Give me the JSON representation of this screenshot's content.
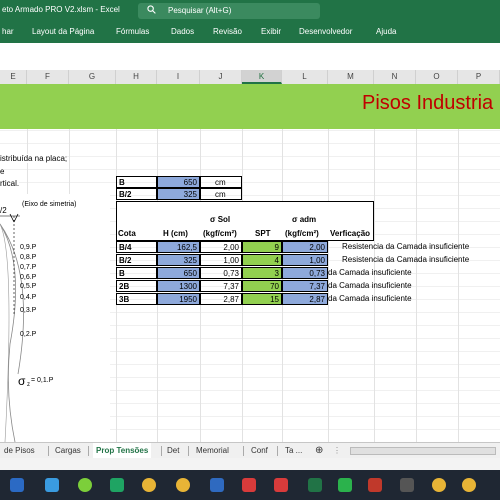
{
  "window": {
    "title": "eto Armado PRO V2.xlsm  -  Excel",
    "search_placeholder": "Pesquisar (Alt+G)"
  },
  "ribbon_tabs": [
    "har",
    "Layout da Página",
    "Fórmulas",
    "Dados",
    "Revisão",
    "Exibir",
    "Desenvolvedor",
    "Ajuda"
  ],
  "columns": [
    "E",
    "F",
    "G",
    "H",
    "I",
    "J",
    "K",
    "L",
    "M",
    "N",
    "O",
    "P"
  ],
  "selected_column": "K",
  "sheet": {
    "title": "Pisos Industria",
    "notes": [
      "istribuída na placa;",
      "e",
      "rtical."
    ],
    "diagram": {
      "half_label": "/2",
      "axis_label": "(Eixo de simetria)",
      "levels": [
        "0,9.P",
        "0,8.P",
        "0,7.P",
        "0,6.P",
        "0,5.P",
        "0,4.P",
        "0,3.P",
        "0,2.P"
      ],
      "sigma": "σ",
      "sigma_sub": "z",
      "sigma_rest": " = 0,1.P"
    },
    "b_table": [
      {
        "label": "B",
        "value": "650",
        "unit": "cm"
      },
      {
        "label": "B/2",
        "value": "325",
        "unit": "cm"
      }
    ],
    "headers": {
      "cota": "Cota",
      "h": "H (cm)",
      "sol_1": "σ Sol",
      "sol_2": "(kgf/cm²)",
      "spt": "SPT",
      "adm_1": "σ adm",
      "adm_2": "(kgf/cm²)",
      "verif": "Verficação"
    },
    "rows": [
      {
        "cota": "B/4",
        "h": "162,5",
        "sol": "2,00",
        "spt": "9",
        "adm": "2,00",
        "verif": "Resistencia da Camada insuficiente"
      },
      {
        "cota": "B/2",
        "h": "325",
        "sol": "1,00",
        "spt": "4",
        "adm": "1,00",
        "verif": "Resistencia da Camada insuficiente"
      },
      {
        "cota": "B",
        "h": "650",
        "sol": "0,73",
        "spt": "3",
        "adm": "0,73",
        "verif": "da Camada insuficiente"
      },
      {
        "cota": "2B",
        "h": "1300",
        "sol": "7,37",
        "spt": "70",
        "adm": "7,37",
        "verif": "da Camada insuficiente"
      },
      {
        "cota": "3B",
        "h": "1950",
        "sol": "2,87",
        "spt": "15",
        "adm": "2,87",
        "verif": "da Camada insuficiente"
      }
    ]
  },
  "sheet_tabs": [
    "de Pisos",
    "Cargas",
    "Prop Tensões",
    "Det",
    "Memorial",
    "Conf",
    "Ta ..."
  ],
  "active_sheet_tab": "Prop Tensões",
  "colors": {
    "excel_green": "#217346",
    "band_green": "#92d050",
    "title_red": "#c00000",
    "cell_blue": "#8ea9db"
  }
}
